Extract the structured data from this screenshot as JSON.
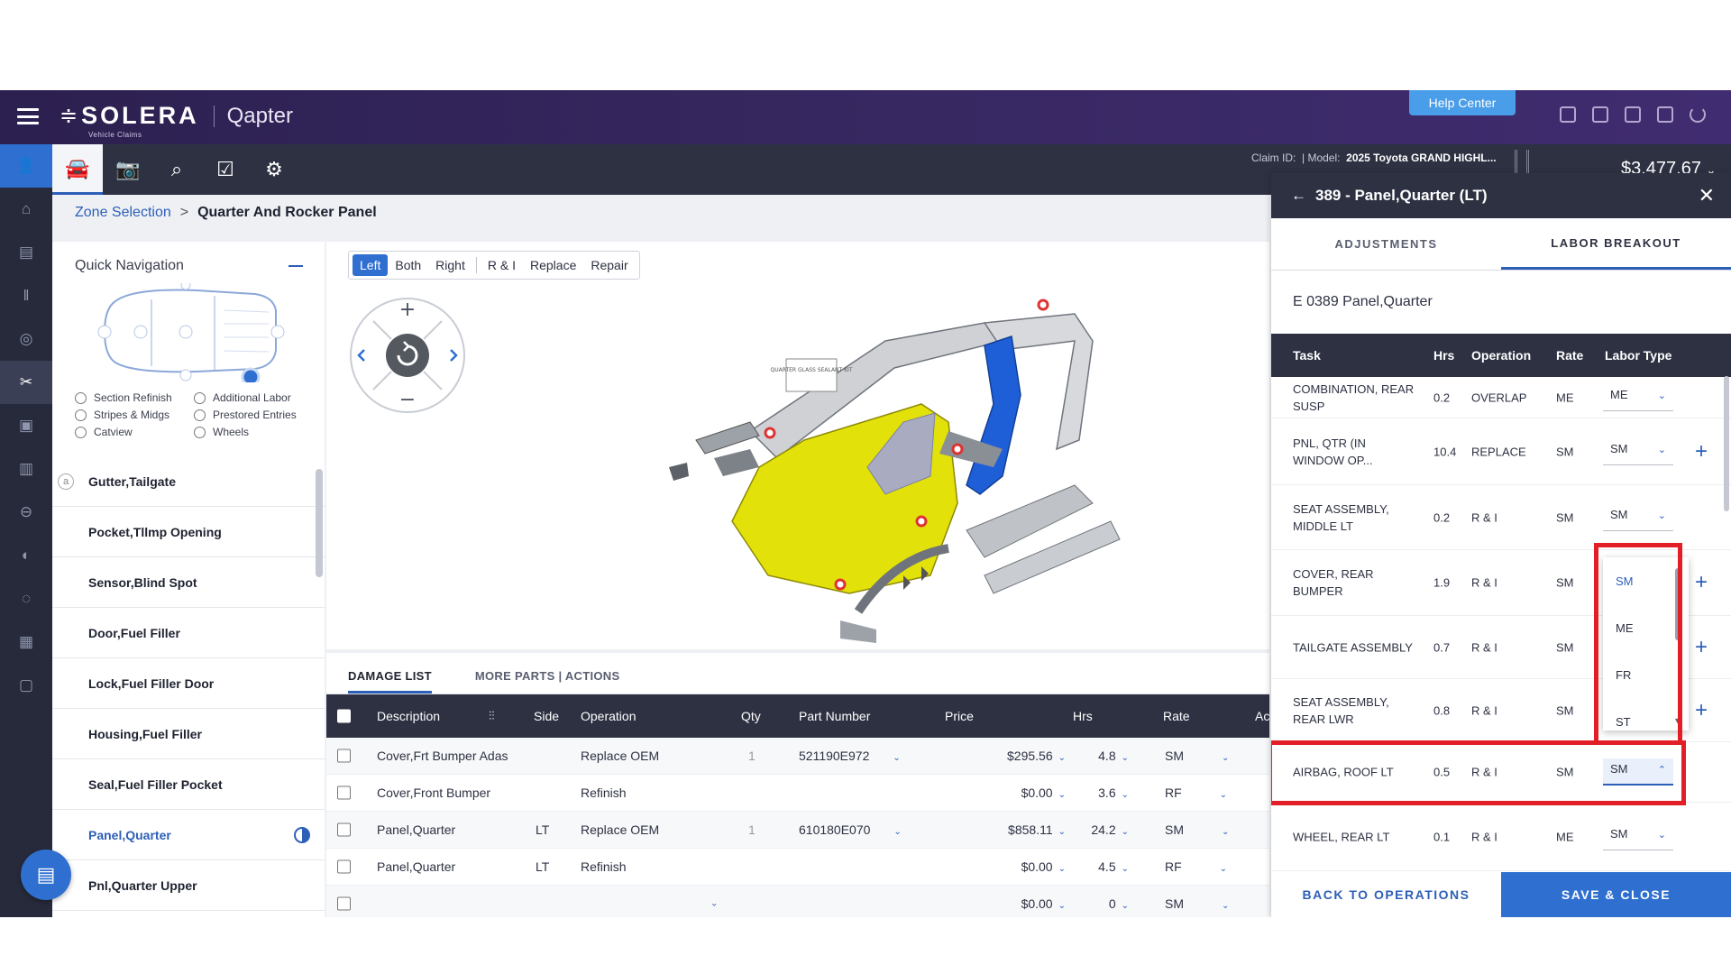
{
  "header": {
    "brand": "SOLERA",
    "brand_sub": "Vehicle Claims",
    "app_name": "Qapter",
    "help_label": "Help Center"
  },
  "toolbar": {
    "claim_label": "Claim ID:",
    "model_label": "| Model:",
    "model_value": "2025 Toyota GRAND HIGHL...",
    "total": "$3,477.67"
  },
  "breadcrumb": {
    "link": "Zone Selection",
    "separator": ">",
    "current": "Quarter And Rocker Panel"
  },
  "quick_nav": {
    "title": "Quick Navigation",
    "options": [
      "Section Refinish",
      "Additional Labor",
      "Stripes & Midgs",
      "Prestored Entries",
      "Catview",
      "Wheels"
    ],
    "badge": "a",
    "parts": [
      {
        "label": "Gutter,Tailgate"
      },
      {
        "label": "Pocket,Tllmp Opening"
      },
      {
        "label": "Sensor,Blind Spot"
      },
      {
        "label": "Door,Fuel Filler"
      },
      {
        "label": "Lock,Fuel Filler Door"
      },
      {
        "label": "Housing,Fuel Filler"
      },
      {
        "label": "Seal,Fuel Filler Pocket"
      },
      {
        "label": "Panel,Quarter"
      },
      {
        "label": "Pnl,Quarter Upper"
      }
    ]
  },
  "viewer": {
    "side_buttons": [
      "Left",
      "Both",
      "Right"
    ],
    "action_buttons": [
      "R & I",
      "Replace",
      "Repair"
    ],
    "sticker_text": "QUARTER GLASS SEALANT KIT"
  },
  "damage_list": {
    "tabs": [
      "DAMAGE LIST",
      "MORE PARTS | ACTIONS"
    ],
    "columns": [
      "Description",
      "Side",
      "Operation",
      "Qty",
      "Part Number",
      "Price",
      "Hrs",
      "Rate",
      "Ac"
    ],
    "rows": [
      {
        "desc": "Cover,Frt Bumper Adas",
        "side": "",
        "op": "Replace OEM",
        "qty": "1",
        "part": "521190E972",
        "price": "$295.56",
        "hrs": "4.8",
        "rate": "SM"
      },
      {
        "desc": "Cover,Front Bumper",
        "side": "",
        "op": "Refinish",
        "qty": "",
        "part": "",
        "price": "$0.00",
        "hrs": "3.6",
        "rate": "RF"
      },
      {
        "desc": "Panel,Quarter",
        "side": "LT",
        "op": "Replace OEM",
        "qty": "1",
        "part": "610180E070",
        "price": "$858.11",
        "hrs": "24.2",
        "rate": "SM"
      },
      {
        "desc": "Panel,Quarter",
        "side": "LT",
        "op": "Refinish",
        "qty": "",
        "part": "",
        "price": "$0.00",
        "hrs": "4.5",
        "rate": "RF"
      },
      {
        "desc": "",
        "side": "",
        "op": "",
        "qty": "",
        "part": "",
        "price": "$0.00",
        "hrs": "0",
        "rate": "SM"
      }
    ]
  },
  "panel": {
    "title": "389 - Panel,Quarter (LT)",
    "tabs": [
      "ADJUSTMENTS",
      "LABOR BREAKOUT"
    ],
    "code": "E 0389 Panel,Quarter",
    "columns": [
      "Task",
      "Hrs",
      "Operation",
      "Rate",
      "Labor Type"
    ],
    "rows": [
      {
        "task": "COMBINATION, REAR SUSP",
        "hrs": "0.2",
        "op": "OVERLAP",
        "rate": "ME",
        "type": "ME",
        "plus": false
      },
      {
        "task": "PNL, QTR (IN WINDOW OP...",
        "hrs": "10.4",
        "op": "REPLACE",
        "rate": "SM",
        "type": "SM",
        "plus": true
      },
      {
        "task": "SEAT ASSEMBLY, MIDDLE LT",
        "hrs": "0.2",
        "op": "R & I",
        "rate": "SM",
        "type": "SM",
        "plus": false
      },
      {
        "task": "COVER, REAR BUMPER",
        "hrs": "1.9",
        "op": "R & I",
        "rate": "SM",
        "type": "",
        "plus": true
      },
      {
        "task": "TAILGATE ASSEMBLY",
        "hrs": "0.7",
        "op": "R & I",
        "rate": "SM",
        "type": "",
        "plus": true
      },
      {
        "task": "SEAT ASSEMBLY, REAR LWR",
        "hrs": "0.8",
        "op": "R & I",
        "rate": "SM",
        "type": "",
        "plus": true
      },
      {
        "task": "AIRBAG, ROOF LT",
        "hrs": "0.5",
        "op": "R & I",
        "rate": "SM",
        "type": "SM",
        "plus": false
      },
      {
        "task": "WHEEL, REAR LT",
        "hrs": "0.1",
        "op": "R & I",
        "rate": "ME",
        "type": "SM",
        "plus": false
      }
    ],
    "dropdown_options": [
      "SM",
      "ME",
      "FR",
      "ST"
    ],
    "back_label": "BACK TO OPERATIONS",
    "save_label": "SAVE & CLOSE"
  },
  "colors": {
    "accent": "#2f6fd0",
    "header": "#36275f",
    "highlight": "#e21e26"
  }
}
